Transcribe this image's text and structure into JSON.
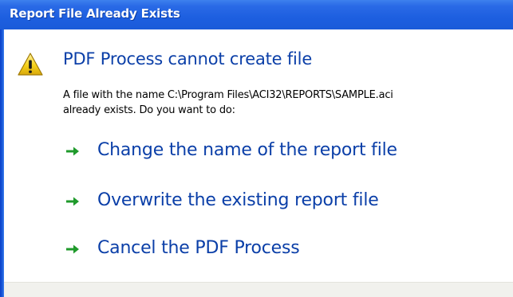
{
  "window": {
    "title": "Report File Already Exists"
  },
  "dialog": {
    "icon": "warning-icon",
    "heading": "PDF Process cannot create file",
    "message_line1": "A file with the name C:\\Program Files\\ACI32\\REPORTS\\SAMPLE.aci",
    "message_line2": "already exists.  Do you want to do:"
  },
  "options": [
    {
      "icon": "green-arrow-icon",
      "label": "Change the name of the report file"
    },
    {
      "icon": "green-arrow-icon",
      "label": "Overwrite the existing report file"
    },
    {
      "icon": "green-arrow-icon",
      "label": "Cancel the PDF Process"
    }
  ],
  "colors": {
    "title_bar": "#1d5fe0",
    "heading_text": "#0b3fa8",
    "option_text": "#0b3fa8",
    "arrow": "#1f9a2b",
    "warning_yellow": "#f6d21b",
    "footer": "#f1f1ed"
  }
}
